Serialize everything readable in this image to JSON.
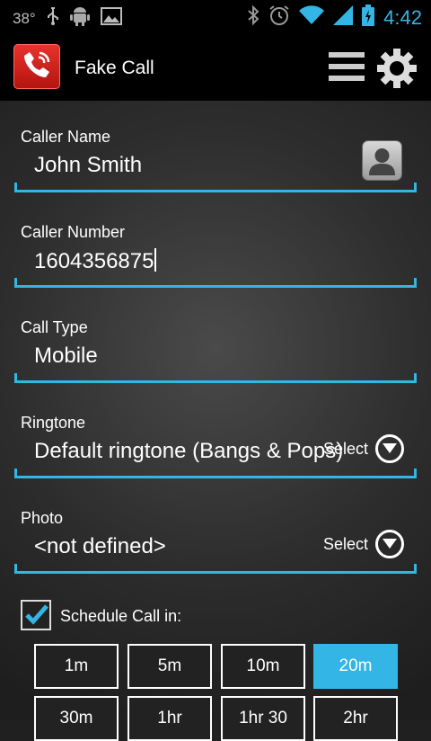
{
  "status_bar": {
    "temperature": "38°",
    "time": "4:42",
    "icons": [
      "usb-icon",
      "android-icon",
      "image-icon",
      "bluetooth-icon",
      "alarm-icon",
      "wifi-icon",
      "signal-icon",
      "battery-icon"
    ]
  },
  "app": {
    "title": "Fake Call",
    "icons": [
      "phone-icon",
      "menu-icon",
      "gear-icon"
    ]
  },
  "form": {
    "caller_name": {
      "label": "Caller Name",
      "value": "John Smith"
    },
    "caller_number": {
      "label": "Caller Number",
      "value": "1604356875"
    },
    "call_type": {
      "label": "Call Type",
      "value": "Mobile"
    },
    "ringtone": {
      "label": "Ringtone",
      "value": "Default ringtone (Bangs & Pops)",
      "select_label": "Select"
    },
    "photo": {
      "label": "Photo",
      "value": "<not defined>",
      "select_label": "Select"
    }
  },
  "schedule": {
    "label": "Schedule Call in:",
    "checked": true,
    "options": [
      "1m",
      "5m",
      "10m",
      "20m",
      "30m",
      "1hr",
      "1hr 30",
      "2hr"
    ],
    "selected": "20m"
  },
  "colors": {
    "accent": "#33b5e5",
    "app_icon": "#d8241d"
  }
}
